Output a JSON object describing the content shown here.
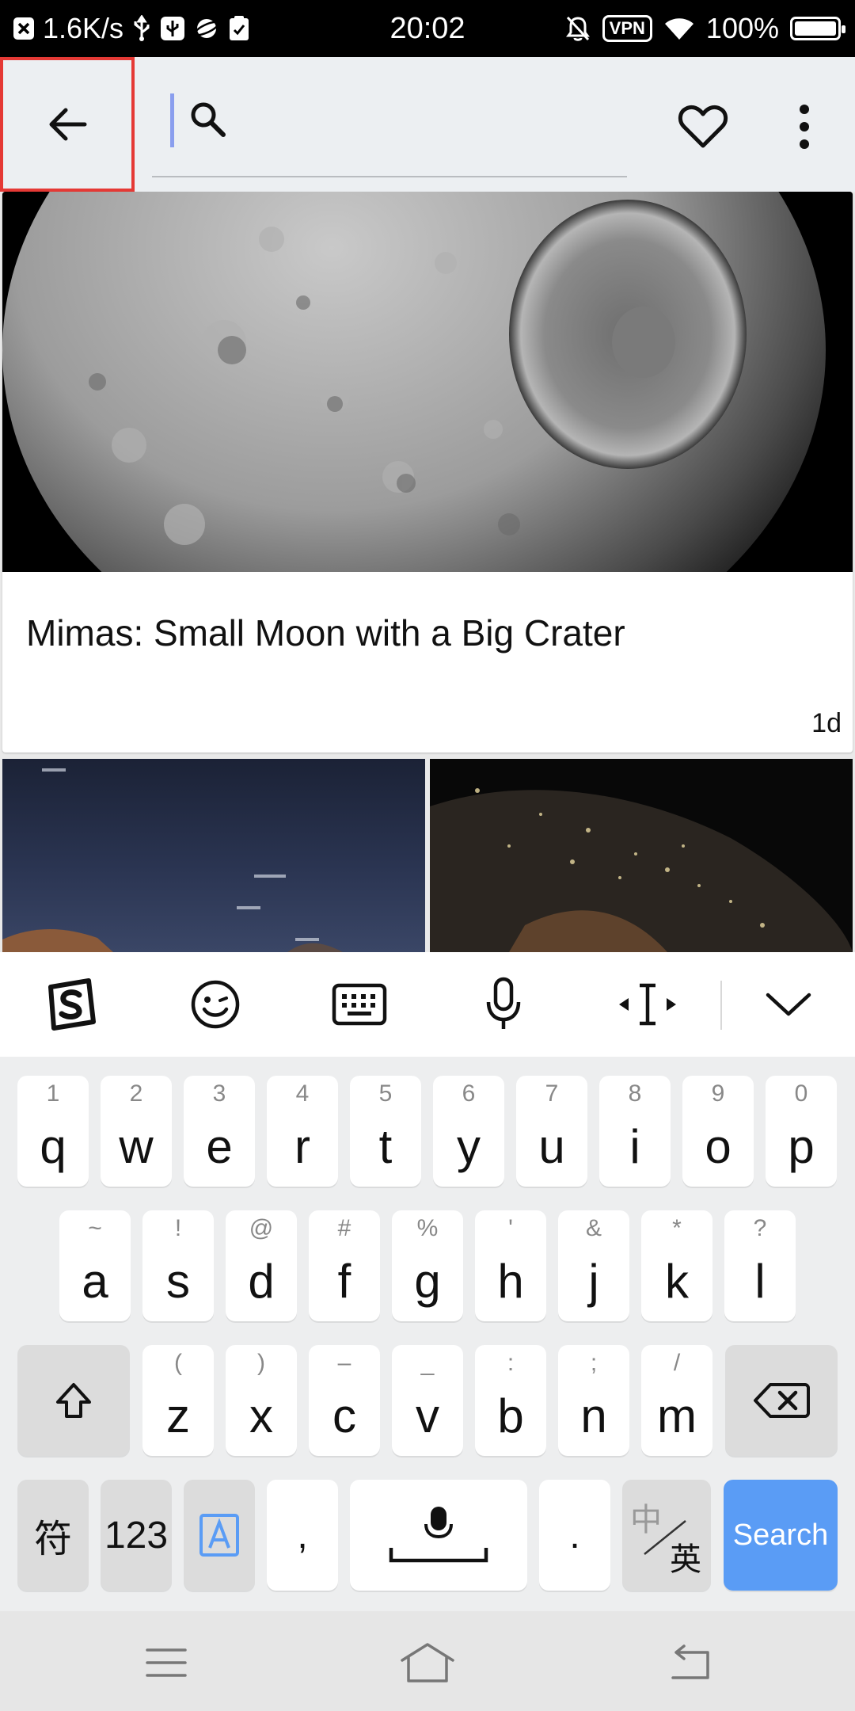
{
  "status_bar": {
    "net_speed": "1.6K/s",
    "time": "20:02",
    "vpn": "VPN",
    "battery": "100%",
    "battery_level": 1.0
  },
  "app_bar": {
    "search_value": "",
    "search_placeholder": ""
  },
  "feed": {
    "featured": {
      "title": "Mimas: Small Moon with a Big Crater",
      "age": "1d"
    }
  },
  "keyboard": {
    "row1": [
      {
        "hint": "1",
        "key": "q"
      },
      {
        "hint": "2",
        "key": "w"
      },
      {
        "hint": "3",
        "key": "e"
      },
      {
        "hint": "4",
        "key": "r"
      },
      {
        "hint": "5",
        "key": "t"
      },
      {
        "hint": "6",
        "key": "y"
      },
      {
        "hint": "7",
        "key": "u"
      },
      {
        "hint": "8",
        "key": "i"
      },
      {
        "hint": "9",
        "key": "o"
      },
      {
        "hint": "0",
        "key": "p"
      }
    ],
    "row2": [
      {
        "hint": "~",
        "key": "a"
      },
      {
        "hint": "!",
        "key": "s"
      },
      {
        "hint": "@",
        "key": "d"
      },
      {
        "hint": "#",
        "key": "f"
      },
      {
        "hint": "%",
        "key": "g"
      },
      {
        "hint": "'",
        "key": "h"
      },
      {
        "hint": "&",
        "key": "j"
      },
      {
        "hint": "*",
        "key": "k"
      },
      {
        "hint": "?",
        "key": "l"
      }
    ],
    "row3": [
      {
        "hint": "(",
        "key": "z"
      },
      {
        "hint": ")",
        "key": "x"
      },
      {
        "hint": "–",
        "key": "c"
      },
      {
        "hint": "_",
        "key": "v"
      },
      {
        "hint": ":",
        "key": "b"
      },
      {
        "hint": ";",
        "key": "n"
      },
      {
        "hint": "/",
        "key": "m"
      }
    ],
    "symbols_label": "符",
    "numbers_label": "123",
    "comma_label": ",",
    "period_label": ".",
    "lang_top": "中",
    "lang_bottom": "英",
    "search_label": "Search",
    "accent_color": "#5a9cf5"
  }
}
